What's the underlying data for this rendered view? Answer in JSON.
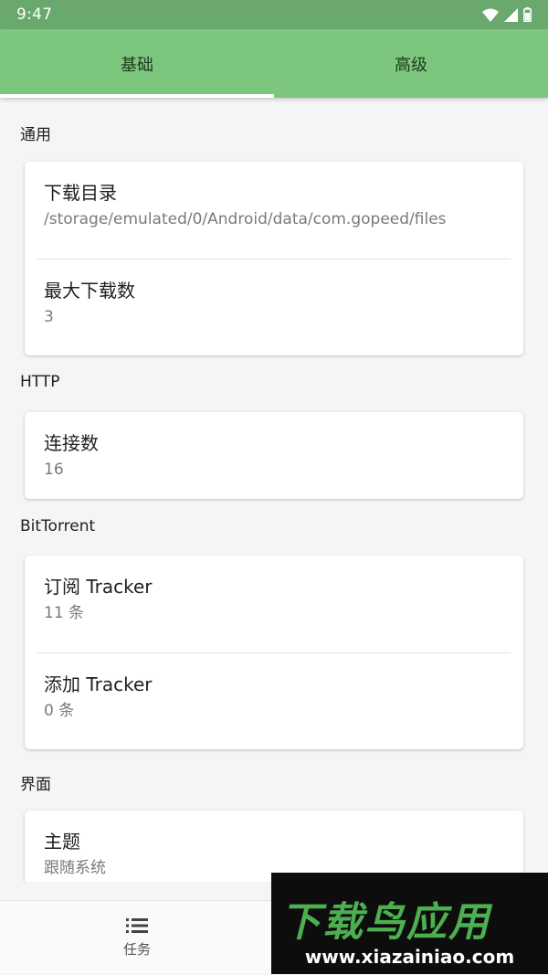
{
  "status_bar": {
    "time": "9:47",
    "icons": [
      "wifi-icon",
      "signal-icon",
      "battery-icon"
    ]
  },
  "tabs": [
    {
      "label": "基础",
      "active": true
    },
    {
      "label": "高级",
      "active": false
    }
  ],
  "sections": [
    {
      "title": "通用",
      "items": [
        {
          "title": "下载目录",
          "value": "/storage/emulated/0/Android/data/com.gopeed/files"
        },
        {
          "title": "最大下载数",
          "value": "3"
        }
      ]
    },
    {
      "title": "HTTP",
      "items": [
        {
          "title": "连接数",
          "value": "16"
        }
      ]
    },
    {
      "title": "BitTorrent",
      "items": [
        {
          "title": "订阅 Tracker",
          "value": "11 条"
        },
        {
          "title": "添加 Tracker",
          "value": "0 条"
        }
      ]
    },
    {
      "title": "界面",
      "items": [
        {
          "title": "主题",
          "value": "跟随系统"
        }
      ]
    }
  ],
  "bottom_nav": {
    "items": [
      {
        "label": "任务",
        "icon": "list-icon"
      }
    ]
  },
  "watermark": {
    "title": "下载鸟应用",
    "url": "www.xiazainiao.com"
  },
  "colors": {
    "status_bar": "#6aa86d",
    "tab_bar": "#7dc67e",
    "indicator": "#ffffff",
    "background": "#f5f5f5",
    "watermark_green": "#4caf50"
  }
}
